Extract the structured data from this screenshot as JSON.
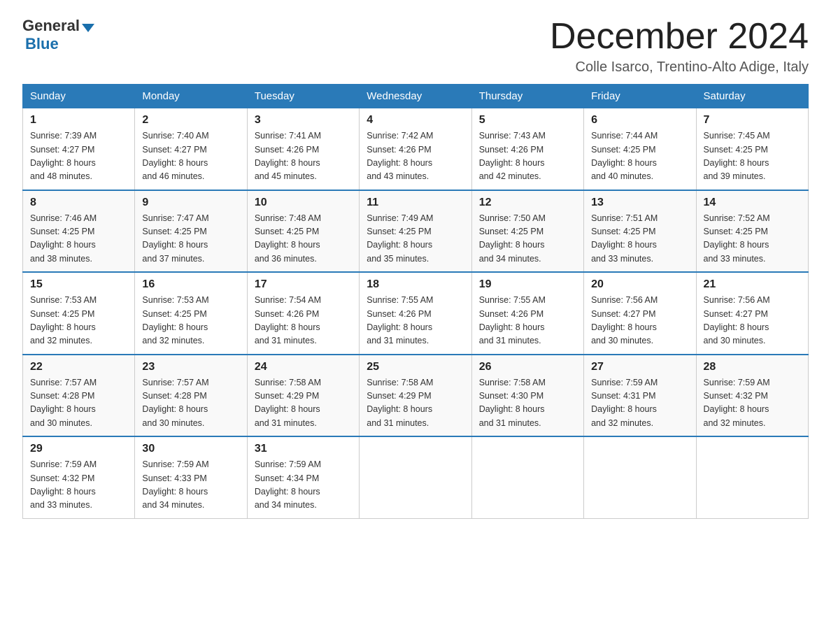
{
  "header": {
    "logo_general": "General",
    "logo_triangle": "▶",
    "logo_blue": "Blue",
    "month_title": "December 2024",
    "location": "Colle Isarco, Trentino-Alto Adige, Italy"
  },
  "days_of_week": [
    "Sunday",
    "Monday",
    "Tuesday",
    "Wednesday",
    "Thursday",
    "Friday",
    "Saturday"
  ],
  "weeks": [
    [
      {
        "day": "1",
        "sunrise": "7:39 AM",
        "sunset": "4:27 PM",
        "daylight": "8 hours and 48 minutes."
      },
      {
        "day": "2",
        "sunrise": "7:40 AM",
        "sunset": "4:27 PM",
        "daylight": "8 hours and 46 minutes."
      },
      {
        "day": "3",
        "sunrise": "7:41 AM",
        "sunset": "4:26 PM",
        "daylight": "8 hours and 45 minutes."
      },
      {
        "day": "4",
        "sunrise": "7:42 AM",
        "sunset": "4:26 PM",
        "daylight": "8 hours and 43 minutes."
      },
      {
        "day": "5",
        "sunrise": "7:43 AM",
        "sunset": "4:26 PM",
        "daylight": "8 hours and 42 minutes."
      },
      {
        "day": "6",
        "sunrise": "7:44 AM",
        "sunset": "4:25 PM",
        "daylight": "8 hours and 40 minutes."
      },
      {
        "day": "7",
        "sunrise": "7:45 AM",
        "sunset": "4:25 PM",
        "daylight": "8 hours and 39 minutes."
      }
    ],
    [
      {
        "day": "8",
        "sunrise": "7:46 AM",
        "sunset": "4:25 PM",
        "daylight": "8 hours and 38 minutes."
      },
      {
        "day": "9",
        "sunrise": "7:47 AM",
        "sunset": "4:25 PM",
        "daylight": "8 hours and 37 minutes."
      },
      {
        "day": "10",
        "sunrise": "7:48 AM",
        "sunset": "4:25 PM",
        "daylight": "8 hours and 36 minutes."
      },
      {
        "day": "11",
        "sunrise": "7:49 AM",
        "sunset": "4:25 PM",
        "daylight": "8 hours and 35 minutes."
      },
      {
        "day": "12",
        "sunrise": "7:50 AM",
        "sunset": "4:25 PM",
        "daylight": "8 hours and 34 minutes."
      },
      {
        "day": "13",
        "sunrise": "7:51 AM",
        "sunset": "4:25 PM",
        "daylight": "8 hours and 33 minutes."
      },
      {
        "day": "14",
        "sunrise": "7:52 AM",
        "sunset": "4:25 PM",
        "daylight": "8 hours and 33 minutes."
      }
    ],
    [
      {
        "day": "15",
        "sunrise": "7:53 AM",
        "sunset": "4:25 PM",
        "daylight": "8 hours and 32 minutes."
      },
      {
        "day": "16",
        "sunrise": "7:53 AM",
        "sunset": "4:25 PM",
        "daylight": "8 hours and 32 minutes."
      },
      {
        "day": "17",
        "sunrise": "7:54 AM",
        "sunset": "4:26 PM",
        "daylight": "8 hours and 31 minutes."
      },
      {
        "day": "18",
        "sunrise": "7:55 AM",
        "sunset": "4:26 PM",
        "daylight": "8 hours and 31 minutes."
      },
      {
        "day": "19",
        "sunrise": "7:55 AM",
        "sunset": "4:26 PM",
        "daylight": "8 hours and 31 minutes."
      },
      {
        "day": "20",
        "sunrise": "7:56 AM",
        "sunset": "4:27 PM",
        "daylight": "8 hours and 30 minutes."
      },
      {
        "day": "21",
        "sunrise": "7:56 AM",
        "sunset": "4:27 PM",
        "daylight": "8 hours and 30 minutes."
      }
    ],
    [
      {
        "day": "22",
        "sunrise": "7:57 AM",
        "sunset": "4:28 PM",
        "daylight": "8 hours and 30 minutes."
      },
      {
        "day": "23",
        "sunrise": "7:57 AM",
        "sunset": "4:28 PM",
        "daylight": "8 hours and 30 minutes."
      },
      {
        "day": "24",
        "sunrise": "7:58 AM",
        "sunset": "4:29 PM",
        "daylight": "8 hours and 31 minutes."
      },
      {
        "day": "25",
        "sunrise": "7:58 AM",
        "sunset": "4:29 PM",
        "daylight": "8 hours and 31 minutes."
      },
      {
        "day": "26",
        "sunrise": "7:58 AM",
        "sunset": "4:30 PM",
        "daylight": "8 hours and 31 minutes."
      },
      {
        "day": "27",
        "sunrise": "7:59 AM",
        "sunset": "4:31 PM",
        "daylight": "8 hours and 32 minutes."
      },
      {
        "day": "28",
        "sunrise": "7:59 AM",
        "sunset": "4:32 PM",
        "daylight": "8 hours and 32 minutes."
      }
    ],
    [
      {
        "day": "29",
        "sunrise": "7:59 AM",
        "sunset": "4:32 PM",
        "daylight": "8 hours and 33 minutes."
      },
      {
        "day": "30",
        "sunrise": "7:59 AM",
        "sunset": "4:33 PM",
        "daylight": "8 hours and 34 minutes."
      },
      {
        "day": "31",
        "sunrise": "7:59 AM",
        "sunset": "4:34 PM",
        "daylight": "8 hours and 34 minutes."
      },
      null,
      null,
      null,
      null
    ]
  ],
  "labels": {
    "sunrise_prefix": "Sunrise: ",
    "sunset_prefix": "Sunset: ",
    "daylight_prefix": "Daylight: "
  }
}
